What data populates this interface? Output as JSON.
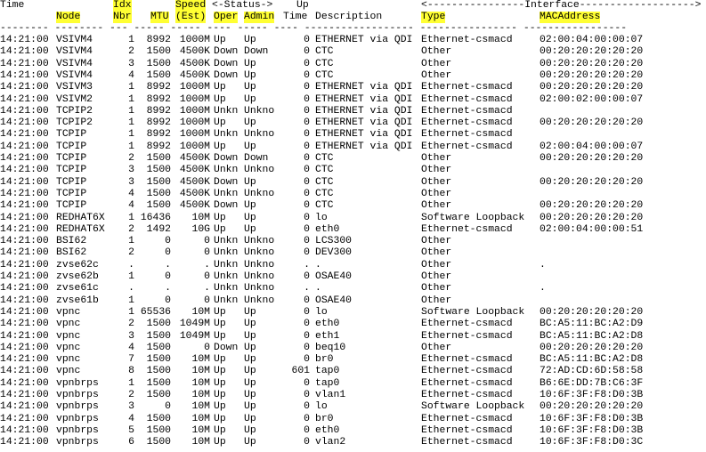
{
  "colors": {
    "highlight": "#ffff33",
    "text": "#000000",
    "background": "#ffffff"
  },
  "header": {
    "time": "Time",
    "node": "Node",
    "idx_top": "Idx",
    "idx_bottom": "Nbr",
    "mtu": "MTU",
    "speed_top": "Speed",
    "speed_bottom": "(Est)",
    "status_group": "<-Status->",
    "oper": "Oper",
    "admin": "Admin",
    "up_top": "Up",
    "up_bottom": "Time",
    "description": "Description",
    "interface_group": "<----------------Interface------------------->",
    "type": "Type",
    "mac": "MACAddress",
    "dashes": "-------- -------- --- ----- ----- ---- ----- ---- ------------------ ---------------- -----------------"
  },
  "rows": [
    [
      "14:21:00",
      "VSIVM4",
      "1",
      "8992",
      "1000M",
      "Up",
      "Up",
      "0",
      "ETHERNET via QDI",
      "Ethernet-csmacd",
      "02:00:04:00:00:07"
    ],
    [
      "14:21:00",
      "VSIVM4",
      "2",
      "1500",
      "4500K",
      "Down",
      "Down",
      "0",
      "CTC",
      "Other",
      "00:20:20:20:20:20"
    ],
    [
      "14:21:00",
      "VSIVM4",
      "3",
      "1500",
      "4500K",
      "Down",
      "Up",
      "0",
      "CTC",
      "Other",
      "00:20:20:20:20:20"
    ],
    [
      "14:21:00",
      "VSIVM4",
      "4",
      "1500",
      "4500K",
      "Down",
      "Up",
      "0",
      "CTC",
      "Other",
      "00:20:20:20:20:20"
    ],
    [
      "14:21:00",
      "VSIVM3",
      "1",
      "8992",
      "1000M",
      "Up",
      "Up",
      "0",
      "ETHERNET via QDI",
      "Ethernet-csmacd",
      "00:20:20:20:20:20"
    ],
    [
      "14:21:00",
      "VSIVM2",
      "1",
      "8992",
      "1000M",
      "Up",
      "Up",
      "0",
      "ETHERNET via QDI",
      "Ethernet-csmacd",
      "02:00:02:00:00:07"
    ],
    [
      "14:21:00",
      "TCPIP2",
      "1",
      "8992",
      "1000M",
      "Unkn",
      "Unkno",
      "0",
      "ETHERNET via QDI",
      "Ethernet-csmacd",
      ""
    ],
    [
      "14:21:00",
      "TCPIP2",
      "1",
      "8992",
      "1000M",
      "Up",
      "Up",
      "0",
      "ETHERNET via QDI",
      "Ethernet-csmacd",
      "00:20:20:20:20:20"
    ],
    [
      "14:21:00",
      "TCPIP",
      "1",
      "8992",
      "1000M",
      "Unkn",
      "Unkno",
      "0",
      "ETHERNET via QDI",
      "Ethernet-csmacd",
      ""
    ],
    [
      "14:21:00",
      "TCPIP",
      "1",
      "8992",
      "1000M",
      "Up",
      "Up",
      "0",
      "ETHERNET via QDI",
      "Ethernet-csmacd",
      "02:00:04:00:00:07"
    ],
    [
      "14:21:00",
      "TCPIP",
      "2",
      "1500",
      "4500K",
      "Down",
      "Down",
      "0",
      "CTC",
      "Other",
      "00:20:20:20:20:20"
    ],
    [
      "14:21:00",
      "TCPIP",
      "3",
      "1500",
      "4500K",
      "Unkn",
      "Unkno",
      "0",
      "CTC",
      "Other",
      ""
    ],
    [
      "14:21:00",
      "TCPIP",
      "3",
      "1500",
      "4500K",
      "Down",
      "Up",
      "0",
      "CTC",
      "Other",
      "00:20:20:20:20:20"
    ],
    [
      "14:21:00",
      "TCPIP",
      "4",
      "1500",
      "4500K",
      "Unkn",
      "Unkno",
      "0",
      "CTC",
      "Other",
      ""
    ],
    [
      "14:21:00",
      "TCPIP",
      "4",
      "1500",
      "4500K",
      "Down",
      "Up",
      "0",
      "CTC",
      "Other",
      "00:20:20:20:20:20"
    ],
    [
      "14:21:00",
      "REDHAT6X",
      "1",
      "16436",
      "10M",
      "Up",
      "Up",
      "0",
      "lo",
      "Software Loopback",
      "00:20:20:20:20:20"
    ],
    [
      "14:21:00",
      "REDHAT6X",
      "2",
      "1492",
      "10G",
      "Up",
      "Up",
      "0",
      "eth0",
      "Ethernet-csmacd",
      "02:00:04:00:00:51"
    ],
    [
      "14:21:00",
      "BSI62",
      "1",
      "0",
      "0",
      "Unkn",
      "Unkno",
      "0",
      "LCS300",
      "Other",
      ""
    ],
    [
      "14:21:00",
      "BSI62",
      "2",
      "0",
      "0",
      "Unkn",
      "Unkno",
      "0",
      "DEV300",
      "Other",
      ""
    ],
    [
      "14:21:00",
      "zvse62c",
      ".",
      ".",
      ".",
      "Unkn",
      "Unkno",
      ".",
      ".",
      "Other",
      "."
    ],
    [
      "14:21:00",
      "zvse62b",
      "1",
      "0",
      "0",
      "Unkn",
      "Unkno",
      "0",
      "OSAE40",
      "Other",
      ""
    ],
    [
      "14:21:00",
      "zvse61c",
      ".",
      ".",
      ".",
      "Unkn",
      "Unkno",
      ".",
      ".",
      "Other",
      "."
    ],
    [
      "14:21:00",
      "zvse61b",
      "1",
      "0",
      "0",
      "Unkn",
      "Unkno",
      "0",
      "OSAE40",
      "Other",
      ""
    ],
    [
      "14:21:00",
      "vpnc",
      "1",
      "65536",
      "10M",
      "Up",
      "Up",
      "0",
      "lo",
      "Software Loopback",
      "00:20:20:20:20:20"
    ],
    [
      "14:21:00",
      "vpnc",
      "2",
      "1500",
      "1049M",
      "Up",
      "Up",
      "0",
      "eth0",
      "Ethernet-csmacd",
      "BC:A5:11:BC:A2:D9"
    ],
    [
      "14:21:00",
      "vpnc",
      "3",
      "1500",
      "1049M",
      "Up",
      "Up",
      "0",
      "eth1",
      "Ethernet-csmacd",
      "BC:A5:11:BC:A2:D8"
    ],
    [
      "14:21:00",
      "vpnc",
      "4",
      "1500",
      "0",
      "Down",
      "Up",
      "0",
      "beq10",
      "Other",
      "00:20:20:20:20:20"
    ],
    [
      "14:21:00",
      "vpnc",
      "7",
      "1500",
      "10M",
      "Up",
      "Up",
      "0",
      "br0",
      "Ethernet-csmacd",
      "BC:A5:11:BC:A2:D8"
    ],
    [
      "14:21:00",
      "vpnc",
      "8",
      "1500",
      "10M",
      "Up",
      "Up",
      "601",
      "tap0",
      "Ethernet-csmacd",
      "72:AD:CD:6D:58:58"
    ],
    [
      "14:21:00",
      "vpnbrps",
      "1",
      "1500",
      "10M",
      "Up",
      "Up",
      "0",
      "tap0",
      "Ethernet-csmacd",
      "B6:6E:DD:7B:C6:3F"
    ],
    [
      "14:21:00",
      "vpnbrps",
      "2",
      "1500",
      "10M",
      "Up",
      "Up",
      "0",
      "vlan1",
      "Ethernet-csmacd",
      "10:6F:3F:F8:D0:3B"
    ],
    [
      "14:21:00",
      "vpnbrps",
      "3",
      "0",
      "10M",
      "Up",
      "Up",
      "0",
      "lo",
      "Software Loopback",
      "00:20:20:20:20:20"
    ],
    [
      "14:21:00",
      "vpnbrps",
      "4",
      "1500",
      "10M",
      "Up",
      "Up",
      "0",
      "br0",
      "Ethernet-csmacd",
      "10:6F:3F:F8:D0:3B"
    ],
    [
      "14:21:00",
      "vpnbrps",
      "5",
      "1500",
      "10M",
      "Up",
      "Up",
      "0",
      "eth0",
      "Ethernet-csmacd",
      "10:6F:3F:F8:D0:3B"
    ],
    [
      "14:21:00",
      "vpnbrps",
      "6",
      "1500",
      "10M",
      "Up",
      "Up",
      "0",
      "vlan2",
      "Ethernet-csmacd",
      "10:6F:3F:F8:D0:3C"
    ]
  ]
}
